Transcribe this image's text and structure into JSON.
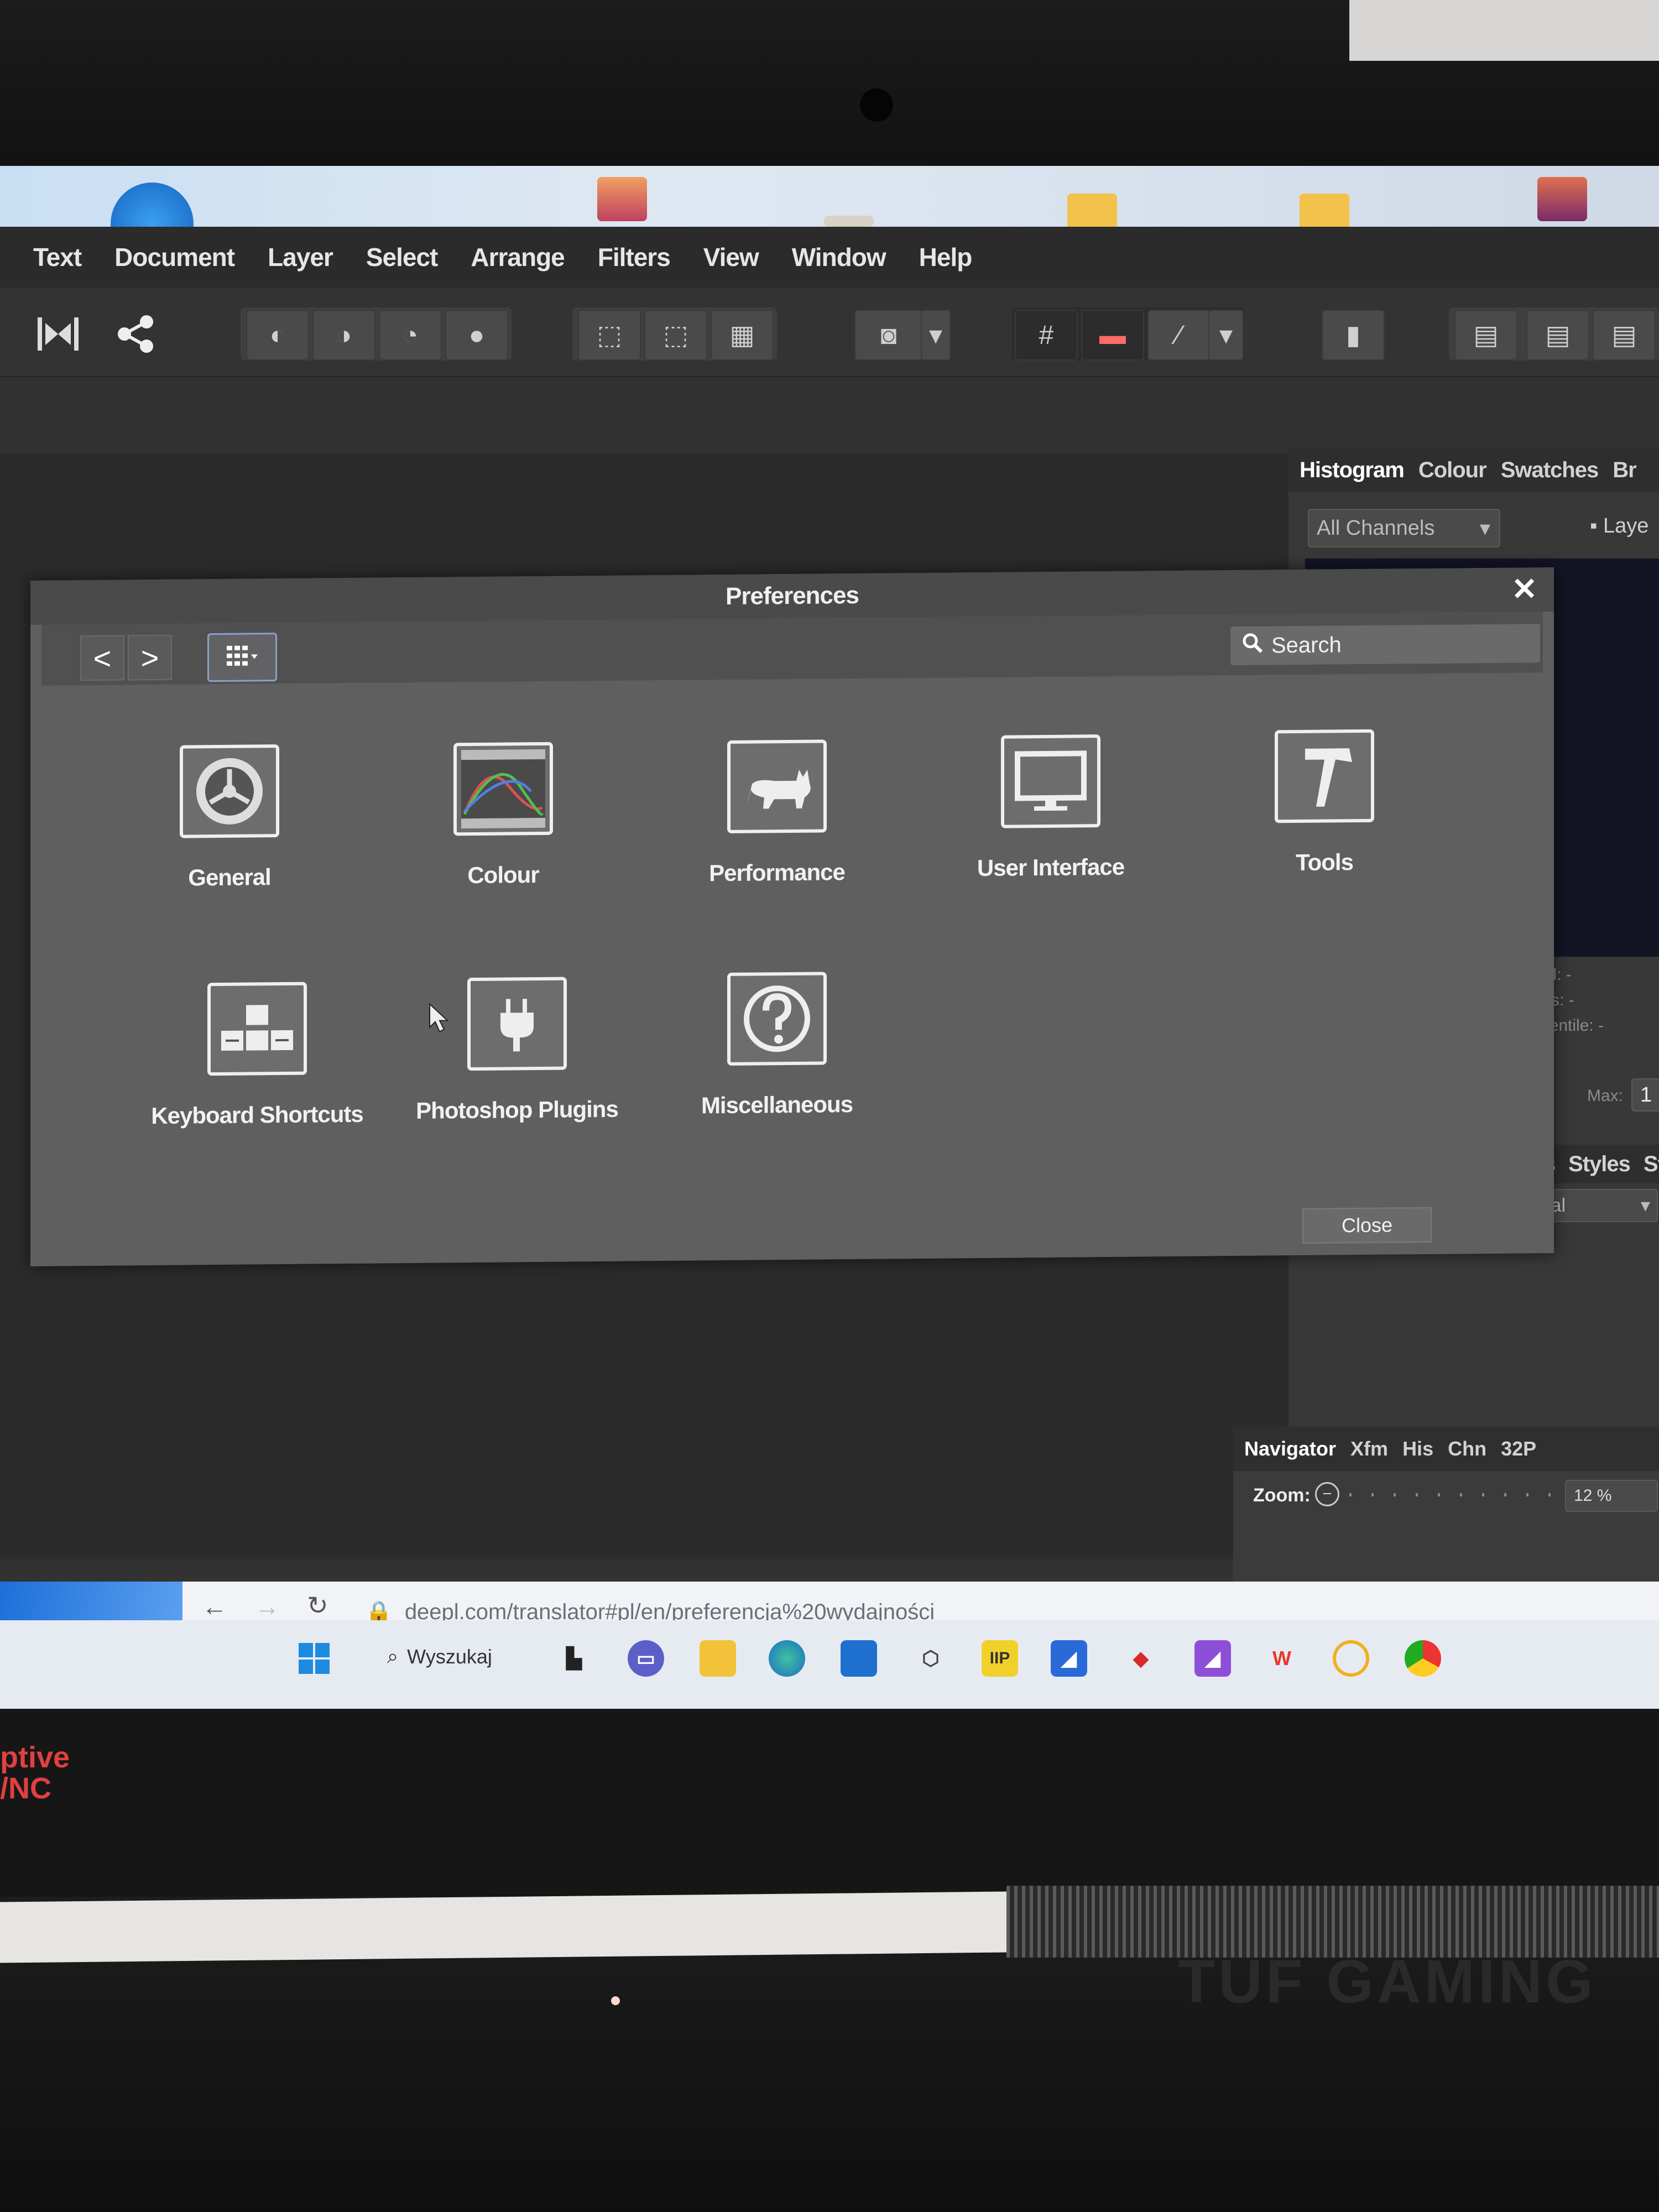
{
  "menubar": {
    "items": [
      "Text",
      "Document",
      "Layer",
      "Select",
      "Arrange",
      "Filters",
      "View",
      "Window",
      "Help"
    ]
  },
  "right_panel": {
    "tabs": [
      "Histogram",
      "Colour",
      "Swatches",
      "Br"
    ],
    "channel_select": "All Channels",
    "layers_label": "Laye",
    "stats": [
      "evel: -",
      "ixels: -",
      "ercentile: -"
    ],
    "max_label": "Max:",
    "max_value": "1",
    "tabs2": [
      "ects",
      "Styles",
      "Sto"
    ],
    "blend_select": "ormal"
  },
  "dialog": {
    "title": "Preferences",
    "search_placeholder": "Search",
    "close_label": "Close",
    "items": [
      {
        "label": "General",
        "icon": "gear-icon"
      },
      {
        "label": "Colour",
        "icon": "colour-curves-icon"
      },
      {
        "label": "Performance",
        "icon": "cat-icon"
      },
      {
        "label": "User Interface",
        "icon": "monitor-icon"
      },
      {
        "label": "Tools",
        "icon": "hammer-icon"
      },
      {
        "label": "Keyboard Shortcuts",
        "icon": "keyboard-keys-icon"
      },
      {
        "label": "Photoshop Plugins",
        "icon": "plug-icon"
      },
      {
        "label": "Miscellaneous",
        "icon": "question-icon"
      }
    ]
  },
  "navigator": {
    "tabs": [
      "Navigator",
      "Xfm",
      "His",
      "Chn",
      "32P"
    ],
    "zoom_label": "Zoom:",
    "zoom_value": "12 %"
  },
  "browser": {
    "url": "deepl.com/translator#pl/en/preferencja%20wydajności"
  },
  "taskbar": {
    "search_label": "Wyszukaj",
    "icons": [
      "windows-start-icon",
      "search-icon",
      "task-view-icon",
      "teams-chat-icon",
      "file-explorer-icon",
      "edge-icon",
      "store-icon",
      "cube-app-icon",
      "iip-app-icon",
      "affinity-designer-icon",
      "mcafee-icon",
      "affinity-photo-icon",
      "wps-office-icon",
      "norton-icon",
      "chrome-icon"
    ],
    "iip_text": "IIP"
  },
  "laptop": {
    "sticker_lines": [
      "ptive",
      "/NC"
    ],
    "brand": "TUF GAMING"
  },
  "colors": {
    "dialog_bg": "#5f5f60",
    "menubar_bg": "#2b2b2c",
    "accent": "#8aa0c8"
  }
}
